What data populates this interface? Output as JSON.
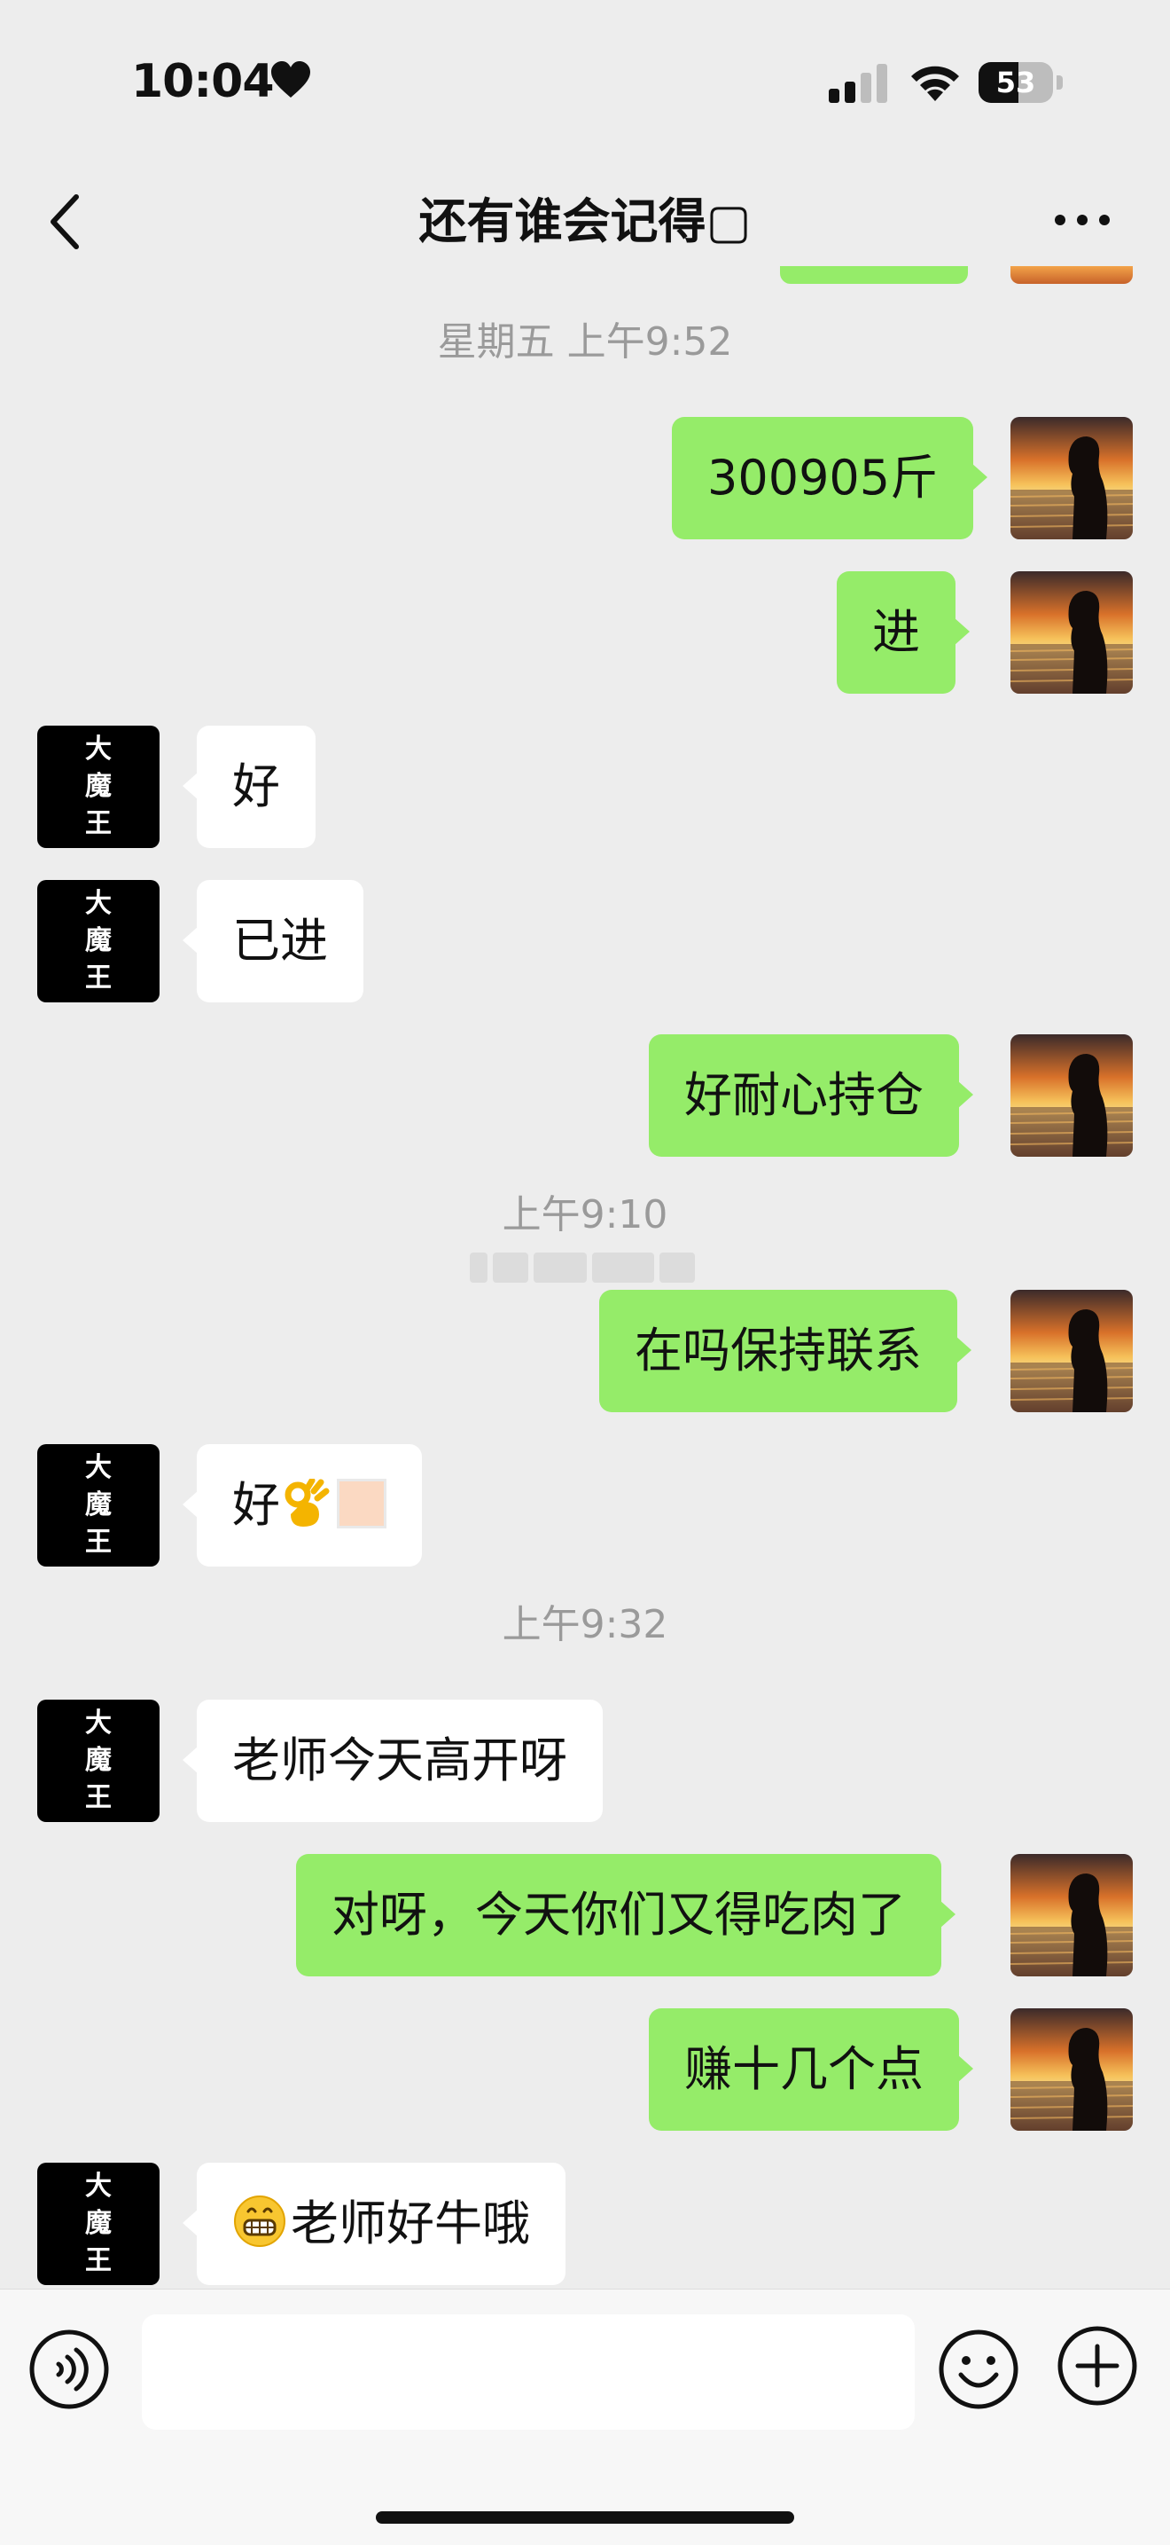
{
  "status_bar": {
    "time": "10:04",
    "battery": "53",
    "battery_level": 0.53
  },
  "header": {
    "title": "还有谁会记得▢"
  },
  "colors": {
    "outgoing_bubble": "#95ec69",
    "incoming_bubble": "#ffffff",
    "background": "#ededed"
  },
  "contact_avatar_text": [
    "大",
    "魔",
    "王"
  ],
  "timestamps": {
    "t1": "星期五 上午9:52",
    "t2": "上午9:10",
    "t3": "上午9:32"
  },
  "messages": [
    {
      "side": "right",
      "text": "300905斤"
    },
    {
      "side": "right",
      "text": "进"
    },
    {
      "side": "left",
      "text": "好"
    },
    {
      "side": "left",
      "text": "已进"
    },
    {
      "side": "right",
      "text": "好耐心持仓"
    },
    {
      "side": "right",
      "text": "在吗保持联系"
    },
    {
      "side": "left",
      "text": "好",
      "emoji": "ok-hand-icon"
    },
    {
      "side": "left",
      "text": "老师今天高开呀"
    },
    {
      "side": "right",
      "text": "对呀，今天你们又得吃肉了"
    },
    {
      "side": "right",
      "text": "赚十几个点"
    },
    {
      "side": "left",
      "text": "老师好牛哦",
      "emoji": "grinning-face-icon"
    }
  ],
  "input": {
    "value": "",
    "placeholder": ""
  },
  "icons": {
    "back": "chevron-left-icon",
    "more": "more-dots-icon",
    "voice": "voice-icon",
    "emoji": "emoji-icon",
    "plus": "plus-icon"
  }
}
